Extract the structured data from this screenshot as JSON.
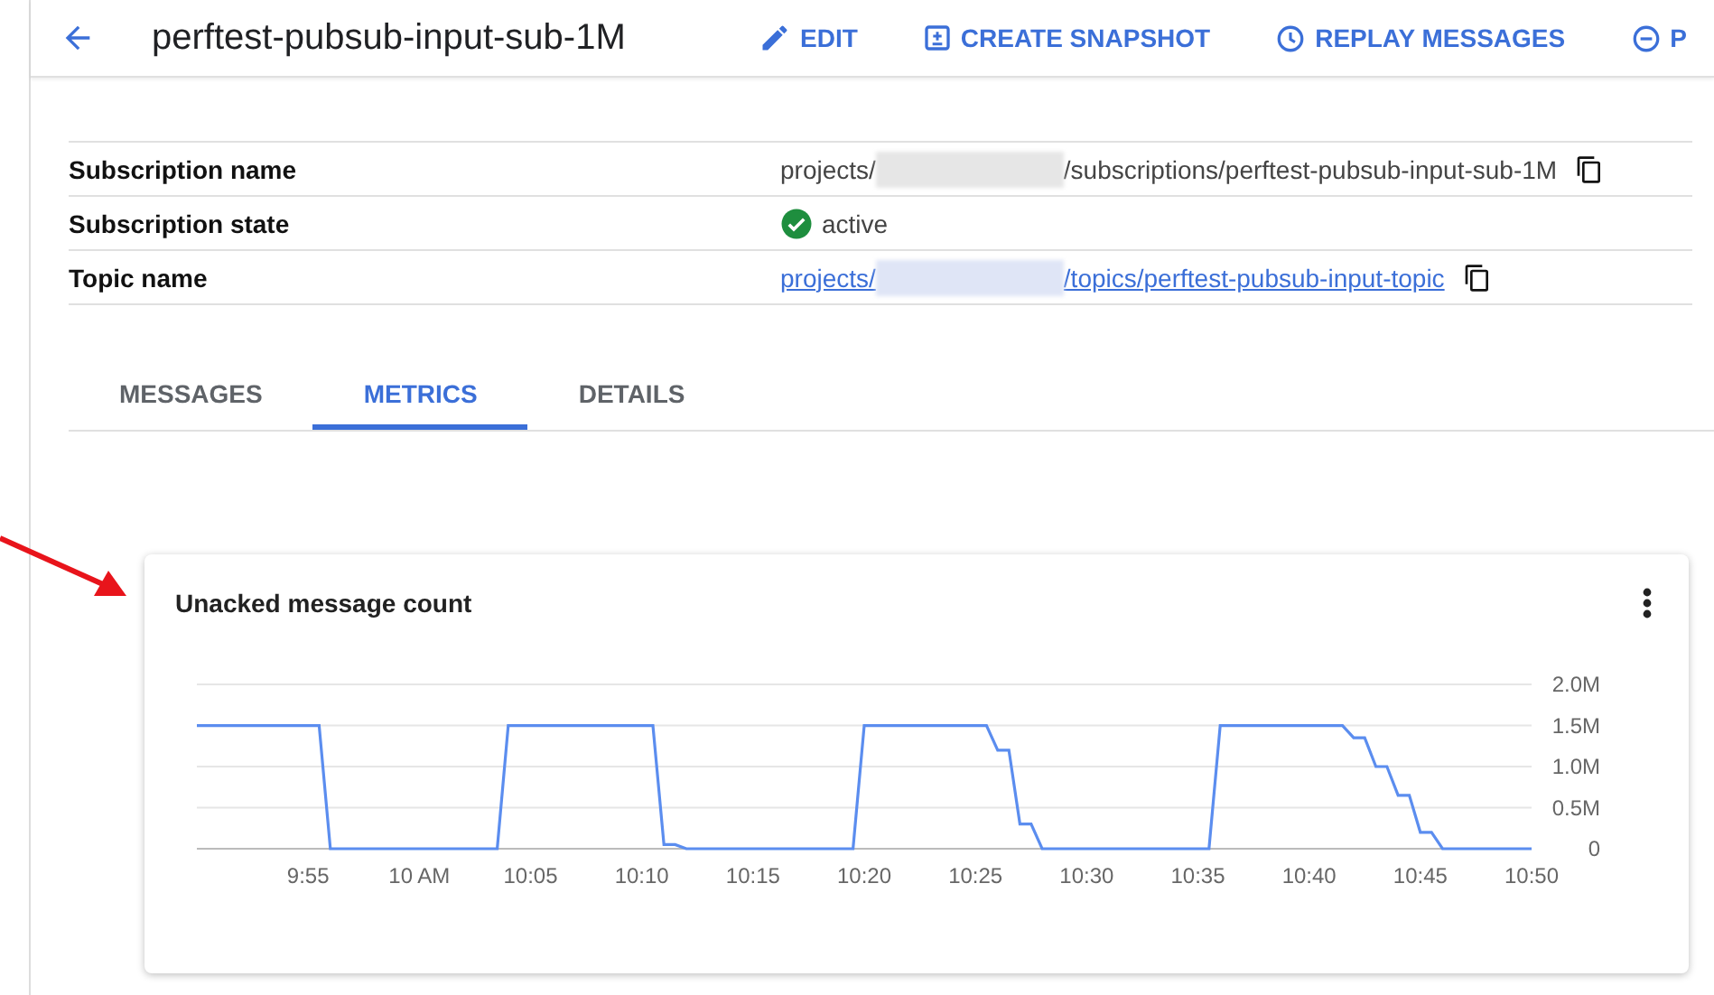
{
  "header": {
    "title": "perftest-pubsub-input-sub-1M",
    "actions": [
      {
        "kind": "edit",
        "label": "EDIT"
      },
      {
        "kind": "snapshot",
        "label": "CREATE SNAPSHOT"
      },
      {
        "kind": "replay",
        "label": "REPLAY MESSAGES"
      },
      {
        "kind": "minus",
        "label": "P"
      }
    ]
  },
  "details": [
    {
      "kind": "path",
      "label": "Subscription name",
      "prefix": "projects/",
      "suffix": "/subscriptions/perftest-pubsub-input-sub-1M",
      "copy": true
    },
    {
      "kind": "status",
      "label": "Subscription state",
      "value": "active"
    },
    {
      "kind": "link",
      "label": "Topic name",
      "prefix": "projects/",
      "suffix": "/topics/perftest-pubsub-input-topic",
      "copy": true
    }
  ],
  "tabs": [
    {
      "label": "MESSAGES",
      "selected": false
    },
    {
      "label": "METRICS",
      "selected": true
    },
    {
      "label": "DETAILS",
      "selected": false
    }
  ],
  "card": {
    "title": "Unacked message count",
    "chart_data": {
      "type": "line",
      "grid": true,
      "ylim": [
        0,
        2000000
      ],
      "yticks": [
        {
          "value": 0,
          "label": "0"
        },
        {
          "value": 500000,
          "label": "0.5M"
        },
        {
          "value": 1000000,
          "label": "1.0M"
        },
        {
          "value": 1500000,
          "label": "1.5M"
        },
        {
          "value": 2000000,
          "label": "2.0M"
        }
      ],
      "categories": [
        null,
        null,
        null,
        null,
        null,
        null,
        null,
        null,
        null,
        null,
        "9:55",
        null,
        null,
        null,
        null,
        null,
        null,
        null,
        null,
        null,
        "10 AM",
        null,
        null,
        null,
        null,
        null,
        null,
        null,
        null,
        null,
        "10:05",
        null,
        null,
        null,
        null,
        null,
        null,
        null,
        null,
        null,
        "10:10",
        null,
        null,
        null,
        null,
        null,
        null,
        null,
        null,
        null,
        "10:15",
        null,
        null,
        null,
        null,
        null,
        null,
        null,
        null,
        null,
        "10:20",
        null,
        null,
        null,
        null,
        null,
        null,
        null,
        null,
        null,
        "10:25",
        null,
        null,
        null,
        null,
        null,
        null,
        null,
        null,
        null,
        "10:30",
        null,
        null,
        null,
        null,
        null,
        null,
        null,
        null,
        null,
        "10:35",
        null,
        null,
        null,
        null,
        null,
        null,
        null,
        null,
        null,
        "10:40",
        null,
        null,
        null,
        null,
        null,
        null,
        null,
        null,
        null,
        "10:45",
        null,
        null,
        null,
        null,
        null,
        null,
        null,
        null,
        null,
        "10:50"
      ],
      "series": [
        {
          "color": "#5b8def",
          "values": [
            1500000,
            1500000,
            1500000,
            1500000,
            1500000,
            1500000,
            1500000,
            1500000,
            1500000,
            1500000,
            1500000,
            1500000,
            0,
            0,
            0,
            0,
            0,
            0,
            0,
            0,
            0,
            0,
            0,
            0,
            0,
            0,
            0,
            0,
            1500000,
            1500000,
            1500000,
            1500000,
            1500000,
            1500000,
            1500000,
            1500000,
            1500000,
            1500000,
            1500000,
            1500000,
            1500000,
            1500000,
            50000,
            50000,
            0,
            0,
            0,
            0,
            0,
            0,
            0,
            0,
            0,
            0,
            0,
            0,
            0,
            0,
            0,
            0,
            1500000,
            1500000,
            1500000,
            1500000,
            1500000,
            1500000,
            1500000,
            1500000,
            1500000,
            1500000,
            1500000,
            1500000,
            1200000,
            1200000,
            300000,
            300000,
            0,
            0,
            0,
            0,
            0,
            0,
            0,
            0,
            0,
            0,
            0,
            0,
            0,
            0,
            0,
            0,
            1500000,
            1500000,
            1500000,
            1500000,
            1500000,
            1500000,
            1500000,
            1500000,
            1500000,
            1500000,
            1500000,
            1500000,
            1350000,
            1350000,
            1000000,
            1000000,
            650000,
            650000,
            200000,
            200000,
            0,
            0,
            0,
            0,
            0,
            0,
            0,
            0,
            0
          ]
        }
      ]
    }
  }
}
